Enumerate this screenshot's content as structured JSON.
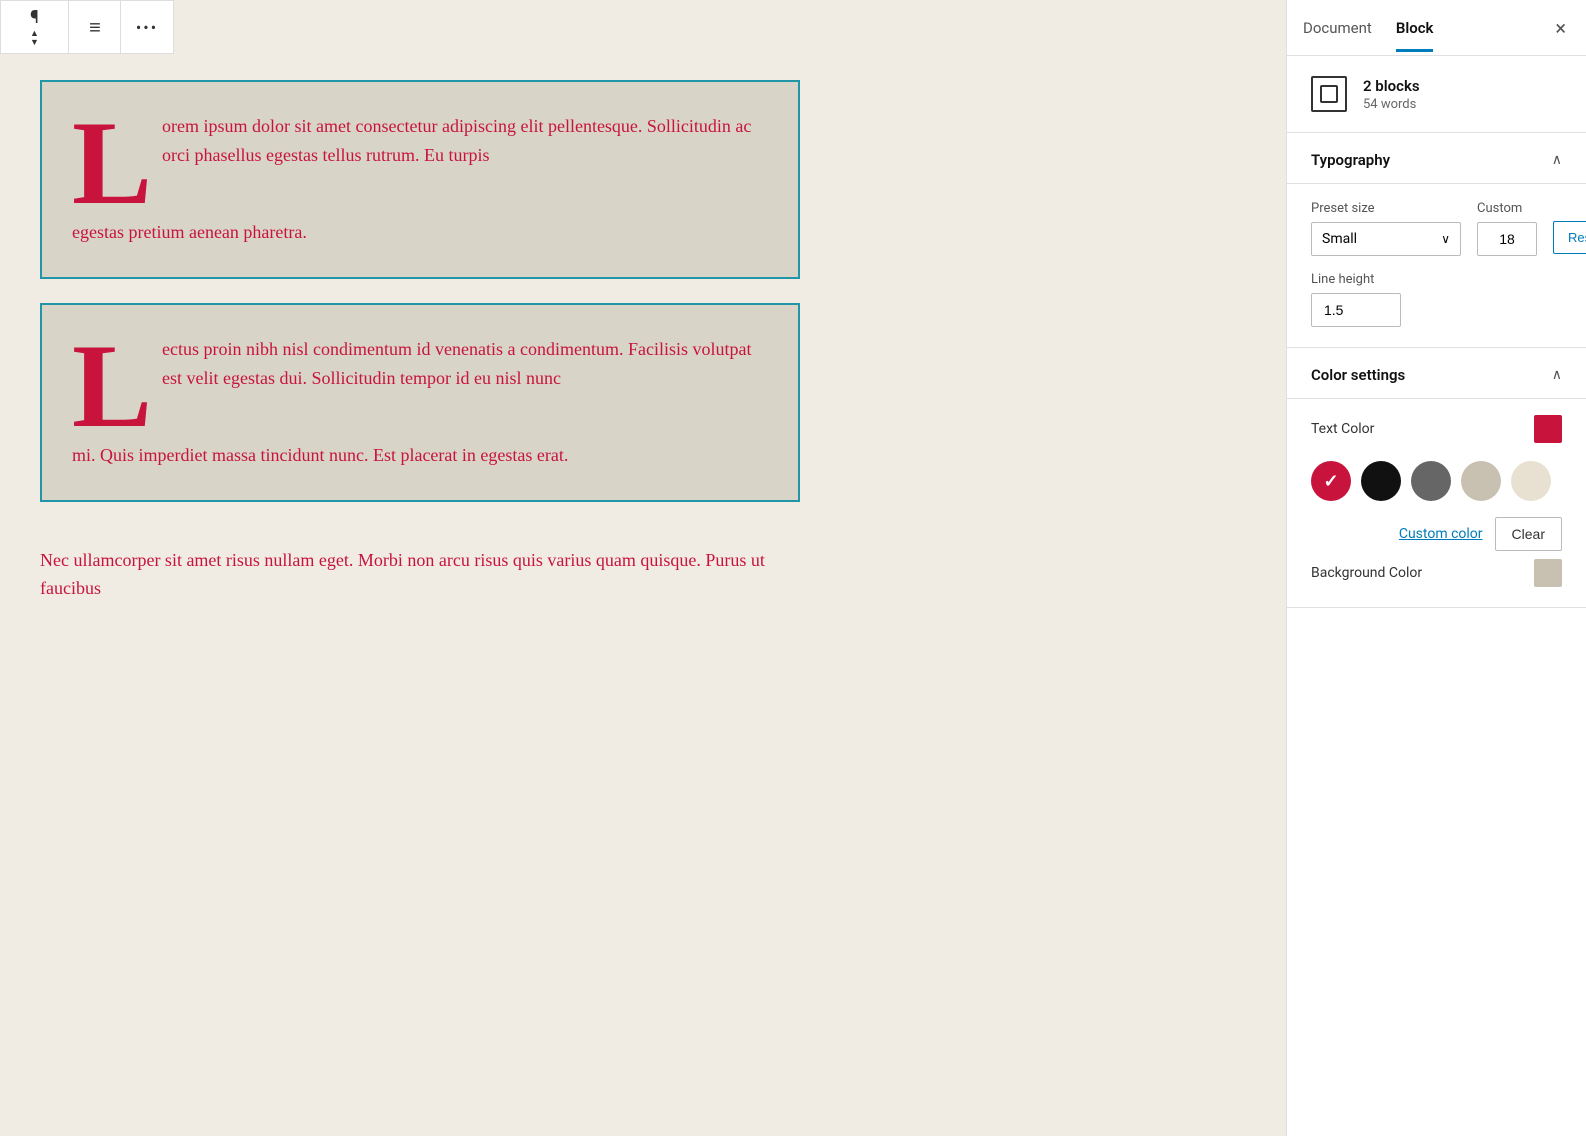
{
  "toolbar": {
    "paragraph_icon": "¶",
    "up_arrow": "▲",
    "down_arrow": "▼",
    "list_icon": "≡",
    "more_icon": "•••"
  },
  "editor": {
    "block1": {
      "drop_cap": "L",
      "text_inline": "orem ipsum dolor sit amet consectetur adipiscing elit pellentesque. Sollicitudin ac orci phasellus egestas tellus rutrum. Eu turpis",
      "text_below": "egestas pretium aenean pharetra."
    },
    "block2": {
      "drop_cap": "L",
      "text_inline": "ectus proin nibh nisl condimentum id venenatis a condimentum. Facilisis volutpat est velit egestas dui. Sollicitudin tempor id eu nisl nunc",
      "text_below": "mi. Quis imperdiet massa tincidunt nunc. Est placerat in egestas erat."
    },
    "block3": {
      "text": "Nec ullamcorper sit amet risus nullam eget. Morbi non arcu risus quis varius quam quisque. Purus ut faucibus"
    }
  },
  "sidebar": {
    "tab_document": "Document",
    "tab_block": "Block",
    "close_label": "×",
    "block_info": {
      "blocks_count": "2 blocks",
      "words_count": "54 words"
    },
    "typography": {
      "section_title": "Typography",
      "preset_label": "Preset size",
      "preset_value": "Small",
      "custom_label": "Custom",
      "custom_value": "18",
      "reset_label": "Reset",
      "line_height_label": "Line height",
      "line_height_value": "1.5"
    },
    "color_settings": {
      "section_title": "Color settings",
      "text_color_label": "Text Color",
      "text_color_hex": "#c8143c",
      "palette": [
        {
          "color": "#c8143c",
          "selected": true
        },
        {
          "color": "#111111",
          "selected": false
        },
        {
          "color": "#666666",
          "selected": false
        },
        {
          "color": "#c8c0b0",
          "selected": false
        },
        {
          "color": "#e8e0d0",
          "selected": false
        }
      ],
      "custom_color_label": "Custom color",
      "clear_label": "Clear",
      "background_color_label": "Background Color",
      "background_color_hex": "#c8c0b0"
    }
  }
}
